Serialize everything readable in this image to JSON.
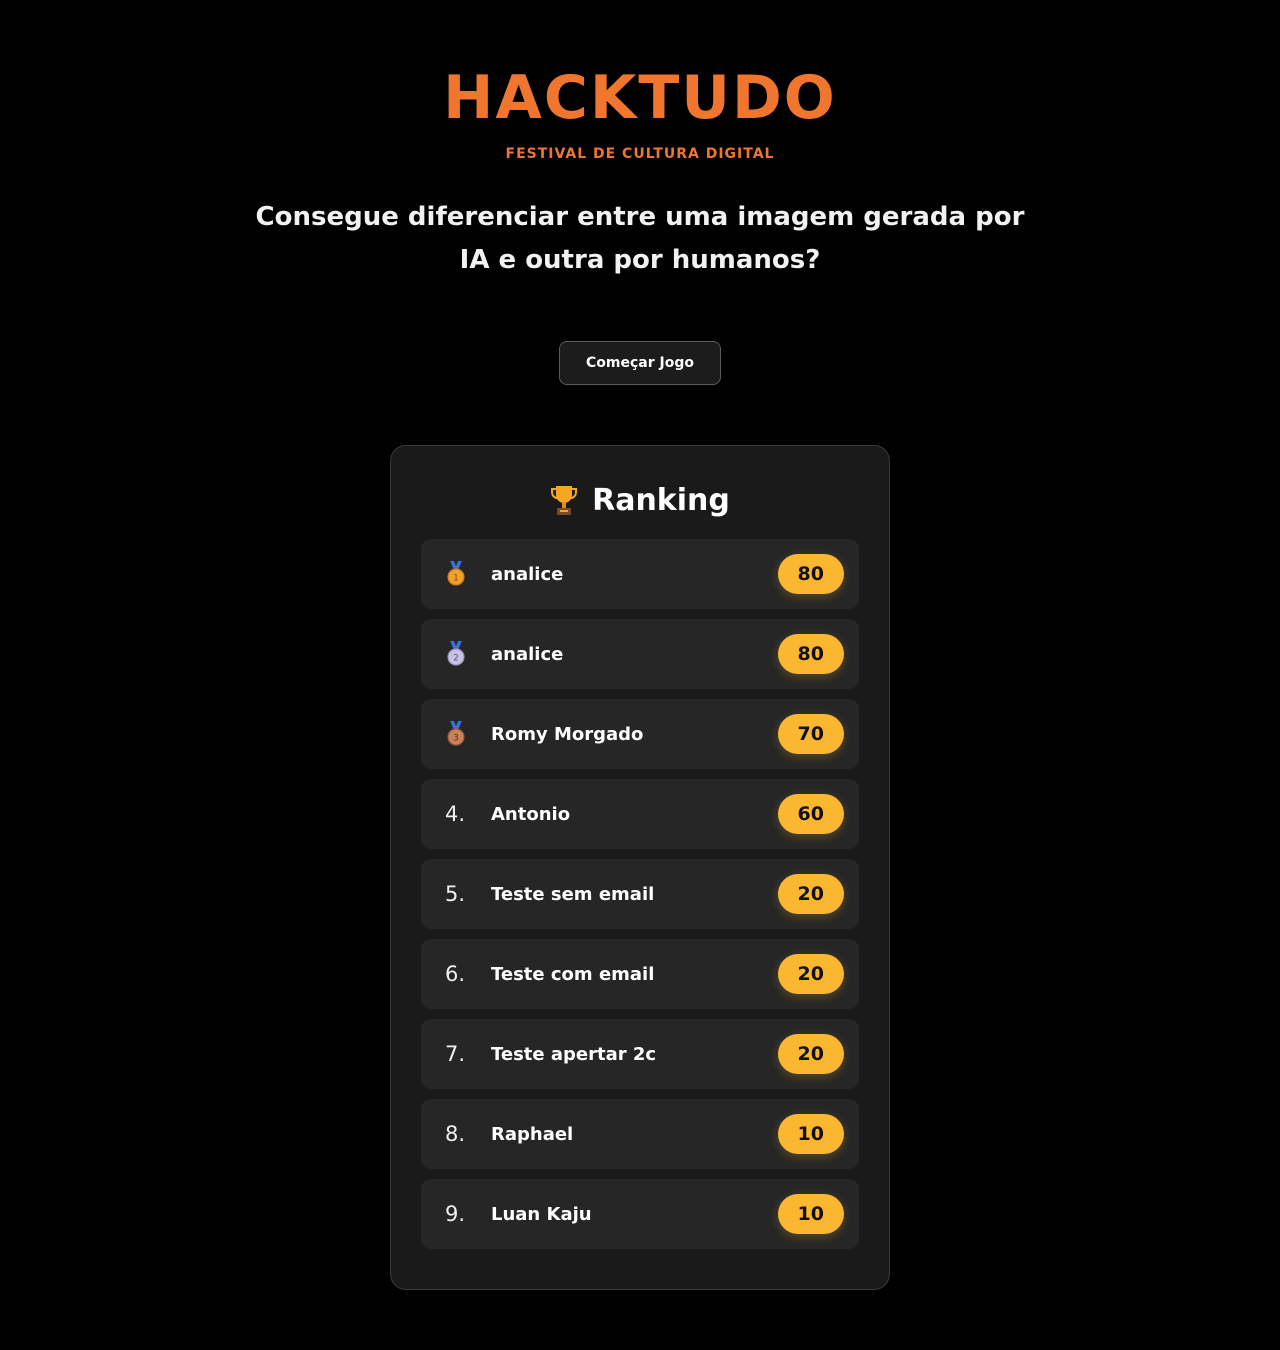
{
  "header": {
    "brand": "HACKTUDO",
    "subtitle": "FESTIVAL DE CULTURA DIGITAL",
    "question": "Consegue diferenciar entre uma imagem gerada por IA e outra por humanos?"
  },
  "actions": {
    "start_label": "Começar Jogo"
  },
  "ranking": {
    "title": "Ranking",
    "title_icon": "trophy-icon",
    "entries": [
      {
        "position": "1",
        "medal": "gold-medal-icon",
        "name": "analice",
        "score": "80"
      },
      {
        "position": "2",
        "medal": "silver-medal-icon",
        "name": "analice",
        "score": "80"
      },
      {
        "position": "3",
        "medal": "bronze-medal-icon",
        "name": "Romy Morgado",
        "score": "70"
      },
      {
        "position": "4.",
        "medal": null,
        "name": "Antonio",
        "score": "60"
      },
      {
        "position": "5.",
        "medal": null,
        "name": "Teste sem email",
        "score": "20"
      },
      {
        "position": "6.",
        "medal": null,
        "name": "Teste com email",
        "score": "20"
      },
      {
        "position": "7.",
        "medal": null,
        "name": "Teste apertar 2c",
        "score": "20"
      },
      {
        "position": "8.",
        "medal": null,
        "name": "Raphael",
        "score": "10"
      },
      {
        "position": "9.",
        "medal": null,
        "name": "Luan Kaju",
        "score": "10"
      }
    ]
  },
  "colors": {
    "brand": "#f0752f",
    "background": "#000000",
    "card": "#1a1a1a",
    "row": "#262626",
    "score_badge": "#fbb731"
  }
}
